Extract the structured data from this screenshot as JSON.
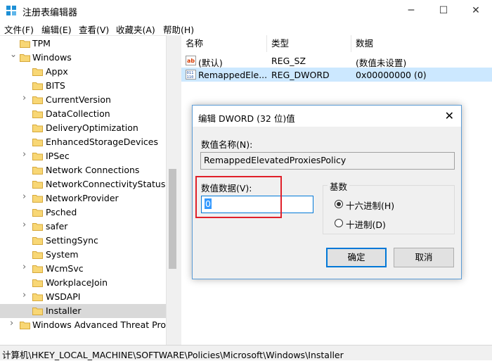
{
  "window": {
    "title": "注册表编辑器",
    "controls": {
      "minimize": "─",
      "maximize": "☐",
      "close": "✕"
    }
  },
  "menu": [
    "文件(F)",
    "编辑(E)",
    "查看(V)",
    "收藏夹(A)",
    "帮助(H)"
  ],
  "tree": {
    "items": [
      {
        "label": "TPM",
        "arrow": ""
      },
      {
        "label": "Windows",
        "arrow": "expanded"
      },
      {
        "label": "Appx",
        "arrow": ""
      },
      {
        "label": "BITS",
        "arrow": ""
      },
      {
        "label": "CurrentVersion",
        "arrow": "collapsed"
      },
      {
        "label": "DataCollection",
        "arrow": ""
      },
      {
        "label": "DeliveryOptimization",
        "arrow": ""
      },
      {
        "label": "EnhancedStorageDevices",
        "arrow": ""
      },
      {
        "label": "IPSec",
        "arrow": "collapsed"
      },
      {
        "label": "Network Connections",
        "arrow": ""
      },
      {
        "label": "NetworkConnectivityStatusInc",
        "arrow": ""
      },
      {
        "label": "NetworkProvider",
        "arrow": "collapsed"
      },
      {
        "label": "Psched",
        "arrow": ""
      },
      {
        "label": "safer",
        "arrow": "collapsed"
      },
      {
        "label": "SettingSync",
        "arrow": ""
      },
      {
        "label": "System",
        "arrow": ""
      },
      {
        "label": "WcmSvc",
        "arrow": "collapsed"
      },
      {
        "label": "WorkplaceJoin",
        "arrow": ""
      },
      {
        "label": "WSDAPI",
        "arrow": "collapsed"
      },
      {
        "label": "Installer",
        "arrow": "",
        "selected": true
      },
      {
        "label": "Windows Advanced Threat Prote",
        "arrow": "collapsed"
      }
    ]
  },
  "list": {
    "headers": [
      "名称",
      "类型",
      "数据"
    ],
    "rows": [
      {
        "icon": "ab-string-icon",
        "name": "(默认)",
        "type": "REG_SZ",
        "data": "(数值未设置)"
      },
      {
        "icon": "binary-dword-icon",
        "name": "RemappedEle...",
        "type": "REG_DWORD",
        "data": "0x00000000 (0)",
        "selected": true
      }
    ]
  },
  "status": {
    "path": "计算机\\HKEY_LOCAL_MACHINE\\SOFTWARE\\Policies\\Microsoft\\Windows\\Installer"
  },
  "dialog": {
    "title": "编辑 DWORD (32 位)值",
    "close_label": "✕",
    "name_label": "数值名称(N):",
    "name_value": "RemappedElevatedProxiesPolicy",
    "data_label": "数值数据(V):",
    "data_value": "0",
    "base_label": "基数",
    "radio_hex": "十六进制(H)",
    "radio_dec": "十进制(D)",
    "base_selected": "hex",
    "ok_label": "确定",
    "cancel_label": "取消"
  },
  "colors": {
    "highlight": "#e0202a",
    "selection": "#cce8ff",
    "folder": "#f8d775",
    "accent": "#0078d7"
  }
}
